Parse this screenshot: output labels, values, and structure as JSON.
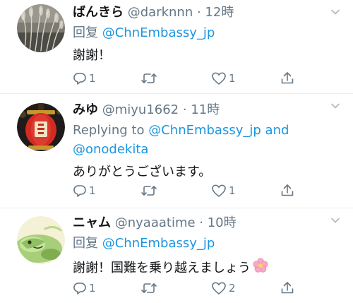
{
  "tweets": [
    {
      "display_name": "ばんきら",
      "handle": "@darknnn",
      "separator": " · ",
      "time": "12時",
      "reply_prefix": "回复",
      "reply_mention_1": "@ChnEmbassy_jp",
      "reply_and": "",
      "reply_mention_2": "",
      "text": "謝謝！",
      "reply_count": "1",
      "retweet_count": "",
      "like_count": "1",
      "avatar_icon": "avatar-dried-grass-photo"
    },
    {
      "display_name": "みゆ",
      "handle": "@miyu1662",
      "separator": " · ",
      "time": "11時",
      "reply_prefix": "Replying to",
      "reply_mention_1": "@ChnEmbassy_jp",
      "reply_and": "and",
      "reply_mention_2": "@onodekita",
      "text": "ありがとうございます。",
      "reply_count": "1",
      "retweet_count": "",
      "like_count": "1",
      "avatar_icon": "avatar-red-lantern-photo"
    },
    {
      "display_name": "ニャム",
      "handle": "@nyaaatime",
      "separator": " · ",
      "time": "10時",
      "reply_prefix": "回复",
      "reply_mention_1": "@ChnEmbassy_jp",
      "reply_and": "",
      "reply_mention_2": "",
      "text": "謝謝！国難を乗り越えましょう",
      "reply_count": "1",
      "retweet_count": "",
      "like_count": "2",
      "avatar_icon": "avatar-green-cartoon"
    }
  ],
  "icons": {
    "reply": "reply-bubble-icon",
    "retweet": "retweet-icon",
    "like": "heart-icon",
    "share": "share-upload-icon",
    "menu": "chevron-down-icon",
    "emoji": "cherry-blossom-icon"
  },
  "colors": {
    "link": "#1b95e0",
    "secondary": "#657786",
    "text": "#14171a",
    "divider": "#e6ecf0"
  }
}
